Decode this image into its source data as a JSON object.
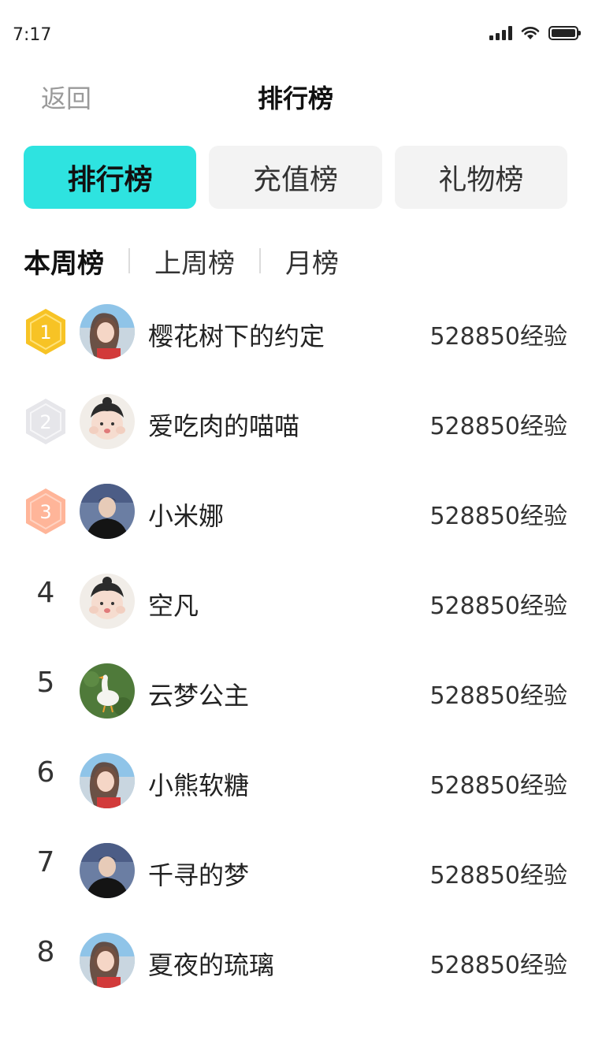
{
  "status_bar": {
    "time": "7:17"
  },
  "nav": {
    "back_label": "返回",
    "title": "排行榜"
  },
  "tabs": [
    {
      "label": "排行榜",
      "active": true
    },
    {
      "label": "充值榜",
      "active": false
    },
    {
      "label": "礼物榜",
      "active": false
    }
  ],
  "periods": [
    {
      "label": "本周榜",
      "active": true
    },
    {
      "label": "上周榜",
      "active": false
    },
    {
      "label": "月榜",
      "active": false
    }
  ],
  "rank_colors": {
    "gold": "#f7c325",
    "silver": "#e6e6ea",
    "bronze": "#ffb599",
    "accent": "#2ee3e0"
  },
  "ranking": [
    {
      "rank": "1",
      "name": "樱花树下的约定",
      "exp": "528850经验",
      "avatar": "girl-beach"
    },
    {
      "rank": "2",
      "name": "爱吃肉的喵喵",
      "exp": "528850经验",
      "avatar": "toddler"
    },
    {
      "rank": "3",
      "name": "小米娜",
      "exp": "528850经验",
      "avatar": "boy-dark"
    },
    {
      "rank": "4",
      "name": "空凡",
      "exp": "528850经验",
      "avatar": "toddler"
    },
    {
      "rank": "5",
      "name": "云梦公主",
      "exp": "528850经验",
      "avatar": "goose-grass"
    },
    {
      "rank": "6",
      "name": "小熊软糖",
      "exp": "528850经验",
      "avatar": "girl-beach"
    },
    {
      "rank": "7",
      "name": "千寻的梦",
      "exp": "528850经验",
      "avatar": "boy-dark"
    },
    {
      "rank": "8",
      "name": "夏夜的琉璃",
      "exp": "528850经验",
      "avatar": "girl-beach"
    }
  ]
}
